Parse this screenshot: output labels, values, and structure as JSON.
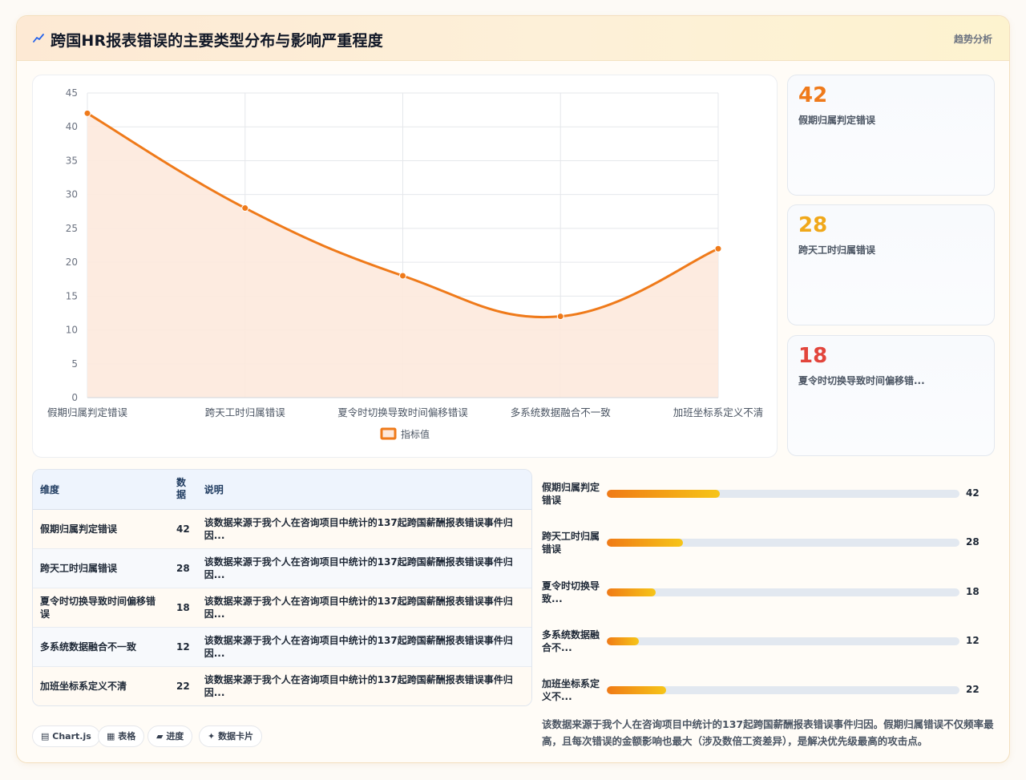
{
  "header": {
    "title": "跨国HR报表错误的主要类型分布与影响严重程度",
    "tag": "趋势分析",
    "icon": "trend-line-icon"
  },
  "chart_data": {
    "type": "line",
    "categories": [
      "假期归属判定错误",
      "跨天工时归属错误",
      "夏令时切换导致时间偏移错误",
      "多系统数据融合不一致",
      "加班坐标系定义不清"
    ],
    "series": [
      {
        "name": "指标值",
        "values": [
          42,
          28,
          18,
          12,
          22
        ]
      }
    ],
    "ylim": [
      0,
      45
    ],
    "yticks": [
      0,
      5,
      10,
      15,
      20,
      25,
      30,
      35,
      40,
      45
    ],
    "area_fill": true,
    "smooth": true,
    "legend_position": "bottom",
    "grid": true,
    "colors": {
      "line": "#ef7a1a",
      "fill": "#fde9dd"
    }
  },
  "kpis": [
    {
      "value": "42",
      "label": "假期归属判定错误",
      "color": "#ef7a1a"
    },
    {
      "value": "28",
      "label": "跨天工时归属错误",
      "color": "#f0a81a"
    },
    {
      "value": "18",
      "label": "夏令时切换导致时间偏移错...",
      "color": "#e2453c"
    }
  ],
  "table": {
    "headers": [
      "维度",
      "数据",
      "说明"
    ],
    "rows": [
      {
        "name": "假期归属判定错误",
        "value": "42",
        "desc": "该数据来源于我个人在咨询项目中统计的137起跨国薪酬报表错误事件归因..."
      },
      {
        "name": "跨天工时归属错误",
        "value": "28",
        "desc": "该数据来源于我个人在咨询项目中统计的137起跨国薪酬报表错误事件归因..."
      },
      {
        "name": "夏令时切换导致时间偏移错误",
        "value": "18",
        "desc": "该数据来源于我个人在咨询项目中统计的137起跨国薪酬报表错误事件归因..."
      },
      {
        "name": "多系统数据融合不一致",
        "value": "12",
        "desc": "该数据来源于我个人在咨询项目中统计的137起跨国薪酬报表错误事件归因..."
      },
      {
        "name": "加班坐标系定义不清",
        "value": "22",
        "desc": "该数据来源于我个人在咨询项目中统计的137起跨国薪酬报表错误事件归因..."
      }
    ]
  },
  "progress": {
    "max": 42,
    "items": [
      {
        "label": "假期归属判定错误",
        "value": 42,
        "fraction": 0.32
      },
      {
        "label": "跨天工时归属错误",
        "value": 28,
        "fraction": 0.215
      },
      {
        "label": "夏令时切换导致...",
        "value": 18,
        "fraction": 0.138
      },
      {
        "label": "多系统数据融合不...",
        "value": 12,
        "fraction": 0.092
      },
      {
        "label": "加班坐标系定义不...",
        "value": 22,
        "fraction": 0.169
      }
    ]
  },
  "note": "该数据来源于我个人在咨询项目中统计的137起跨国薪酬报表错误事件归因。假期归属错误不仅频率最高，且每次错误的金额影响也最大（涉及数倍工资差异），是解决优先级最高的攻击点。",
  "chips": [
    {
      "icon": "chart-icon",
      "label": "Chart.js"
    },
    {
      "icon": "table-icon",
      "label": "表格"
    },
    {
      "icon": "progress-icon",
      "label": "进度"
    },
    {
      "icon": "sparkle-icon",
      "label": "数据卡片"
    }
  ]
}
